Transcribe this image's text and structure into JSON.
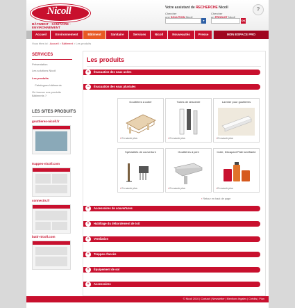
{
  "brand": {
    "logo": "Nicoll",
    "tagline": "BÂTIMENT · SANITAIRE · ENVIRONNEMENT"
  },
  "assistant": {
    "title_prefix": "Votre assistant de",
    "title_highlight": "RECHERCHE",
    "title_suffix": "Nicoll",
    "col1_line1": "Chercher",
    "col1_line2_prefix": "une",
    "col1_line2_bold": "SOLUTION",
    "col1_line2_suffix": "Nicoll",
    "col2_line1": "Chercher",
    "col2_line2_prefix": "un",
    "col2_line2_bold": "PRODUIT",
    "col2_line2_suffix": "Nicoll",
    "go": "OK",
    "help": "?"
  },
  "nav": {
    "items": [
      "Accueil",
      "Environnement",
      "Bâtiment",
      "Sanitaire",
      "Services",
      "Nicoll",
      "Nouveautés",
      "Presse"
    ],
    "active": "Bâtiment",
    "espace": "MON ESPACE PRO"
  },
  "breadcrumb": {
    "prefix": "Vous êtes ici :",
    "home": "Accueil",
    "section": "Bâtiment",
    "current": "Les produits"
  },
  "sidebar": {
    "services_title": "SERVICES",
    "items": [
      "Présentation",
      "Les solutions Nicoll",
      "Les produits",
      "Catalogues bâtiments",
      "Où trouver nos produits",
      "Bâtiments ?"
    ],
    "sites_title": "LES SITES PRODUITS",
    "sites": [
      "gouttieres-nicoll.fr",
      "trappes-nicoll.com",
      "connectis.fr",
      "batir-nicoll.com"
    ]
  },
  "main": {
    "title": "Les produits",
    "accordions_top": [
      "Évacuation des eaux usées",
      "Évacuation des eaux pluviales"
    ],
    "products": [
      {
        "name": "Gouttières à coller",
        "more": "En savoir plus"
      },
      {
        "name": "Tubes de descente",
        "more": "En savoir plus"
      },
      {
        "name": "Larmier pour gouttières",
        "more": "En savoir plus"
      },
      {
        "name": "Spécialités de couverture",
        "more": "En savoir plus"
      },
      {
        "name": "Gouttières à joint",
        "more": "En savoir plus"
      },
      {
        "name": "Colle, Décapant Pâte lubrifiante",
        "more": "En savoir plus"
      }
    ],
    "back_top": "Retour en haut de page",
    "accordions_bottom": [
      "Accessoires de couvertures",
      "Habillage du débordement de toit",
      "Ventilation",
      "Trappes d'accès",
      "Équipement de sol",
      "Accessoires"
    ]
  },
  "footer": {
    "text": "© Nicoll 2010  |  Contact  |  Newsletter  |  Mentions légales  |  Crédits  |  Plan"
  },
  "colors": {
    "brand_red": "#c8102e",
    "active_nav": "#e85a24"
  }
}
